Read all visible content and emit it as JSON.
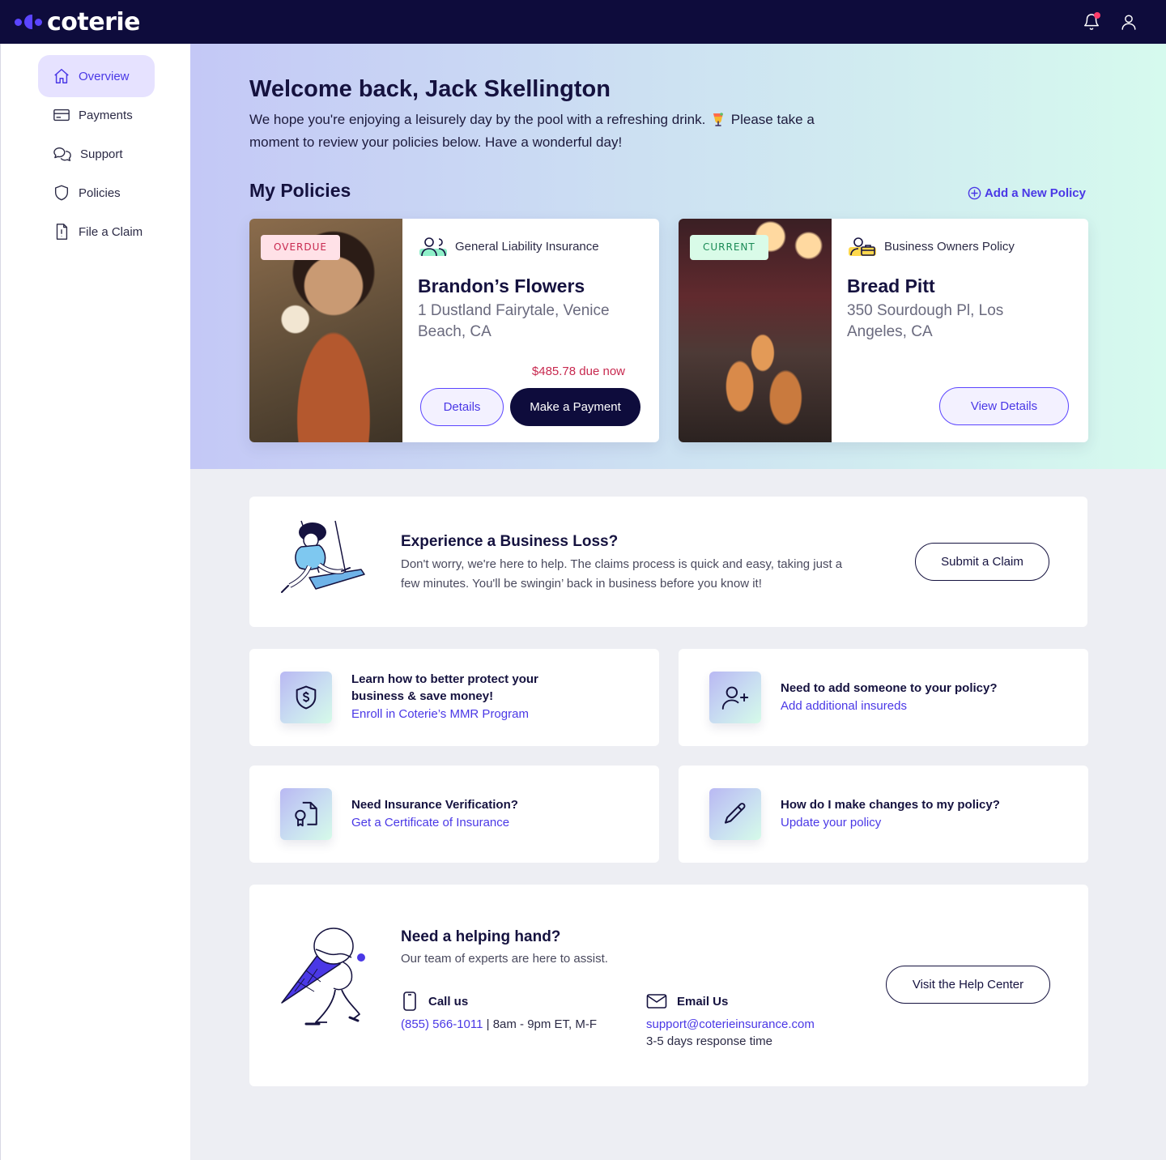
{
  "header": {
    "logo_text": "coterie",
    "has_notification": true
  },
  "sidebar": {
    "items": [
      {
        "label": "Overview",
        "icon": "home-icon",
        "active": true
      },
      {
        "label": "Payments",
        "icon": "card-icon",
        "active": false
      },
      {
        "label": "Support",
        "icon": "chat-icon",
        "active": false
      },
      {
        "label": "Policies",
        "icon": "shield-icon",
        "active": false
      },
      {
        "label": "File a Claim",
        "icon": "document-icon",
        "active": false
      }
    ]
  },
  "hero": {
    "welcome": "Welcome back, Jack Skellington",
    "subtitle_before": "We hope you're enjoying a leisurely day by the pool with a refreshing drink.",
    "subtitle_after": "Please take a moment to review your policies below. Have a wonderful day!",
    "policies_title": "My Policies",
    "add_policy_label": "Add a New Policy"
  },
  "policies": [
    {
      "status": "OVERDUE",
      "type": "General Liability Insurance",
      "name": "Brandon’s Flowers",
      "address": "1 Dustland Fairytale, Venice Beach, CA",
      "due": "$485.78 due now",
      "details_label": "Details",
      "pay_label": "Make a Payment"
    },
    {
      "status": "CURRENT",
      "type": "Business Owners Policy",
      "name": "Bread Pitt",
      "address": "350 Sourdough Pl, Los Angeles, CA",
      "view_label": "View Details"
    }
  ],
  "loss": {
    "title": "Experience a Business Loss?",
    "text": "Don't worry, we're here to help. The claims process is quick and easy, taking just a few minutes. You'll be swingin’ back in business before you know it!",
    "button": "Submit a Claim"
  },
  "info_cards": [
    {
      "question": "Learn how to better protect your business & save money!",
      "link": "Enroll in Coterie’s MMR Program",
      "icon": "shield-dollar-icon"
    },
    {
      "question": "Need to add someone to your policy?",
      "link": "Add additional insureds",
      "icon": "add-user-icon"
    },
    {
      "question": "Need Insurance Verification?",
      "link": "Get a Certificate of Insurance",
      "icon": "certificate-icon"
    },
    {
      "question": "How do I make changes to my policy?",
      "link": "Update your policy",
      "icon": "pencil-icon"
    }
  ],
  "help": {
    "title": "Need a helping hand?",
    "subtitle": "Our team of experts are here to assist.",
    "call_label": "Call us",
    "phone": "(855) 566-1011",
    "hours": " | 8am - 9pm ET, M-F",
    "email_label": "Email Us",
    "email": "support@coterieinsurance.com",
    "email_response": "3-5 days response time",
    "button": "Visit the Help Center"
  },
  "colors": {
    "navy": "#0e0c3c",
    "accent": "#4a38e6",
    "overdue": "#c8294f",
    "current": "#1a8a55"
  }
}
